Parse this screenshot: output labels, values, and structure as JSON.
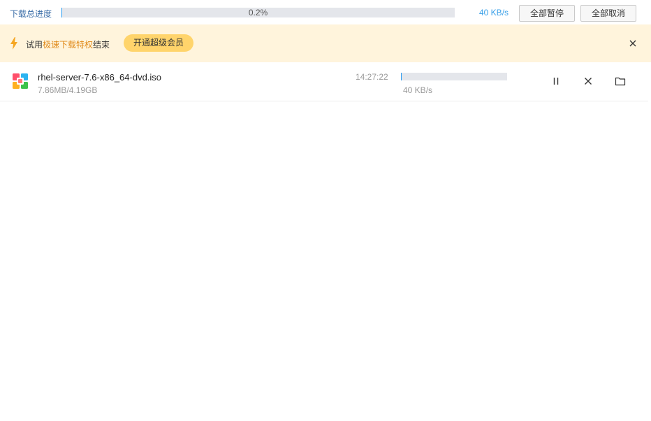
{
  "header": {
    "label": "下载总进度",
    "progress_text": "0.2%",
    "progress_fraction": 0.002,
    "speed": "40 KB/s",
    "pause_all_label": "全部暂停",
    "cancel_all_label": "全部取消"
  },
  "banner": {
    "text_prefix": "试用",
    "text_highlight": "极速下载特权",
    "text_suffix": "结束",
    "vip_button_label": "开通超级会员",
    "icon": "lightning-bolt-icon",
    "close_icon": "close-icon"
  },
  "downloads": [
    {
      "name": "rhel-server-7.6-x86_64-dvd.iso",
      "size": "7.86MB/4.19GB",
      "time": "14:27:22",
      "progress_fraction": 0.002,
      "speed": "40 KB/s",
      "icons": [
        "file-type-icon",
        "pause-icon",
        "close-icon",
        "folder-icon"
      ]
    }
  ],
  "colors": {
    "accent": "#2b9cf0",
    "banner_bg": "#fff4dc",
    "highlight": "#e08a1a",
    "vip_button": "#ffd46b"
  }
}
